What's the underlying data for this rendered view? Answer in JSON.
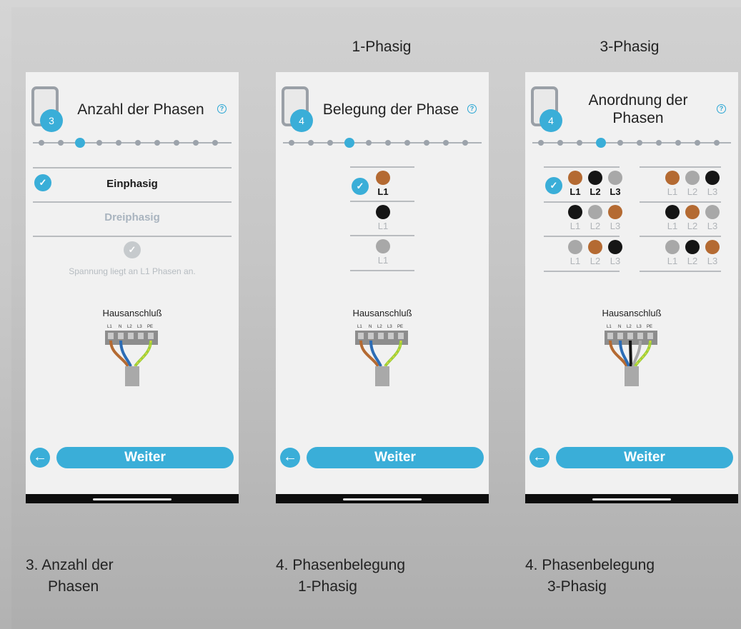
{
  "headers": {
    "one_phase": "1-Phasig",
    "three_phase": "3-Phasig"
  },
  "screens": [
    {
      "title": "Anzahl der Phasen",
      "step": "3",
      "options": [
        "Einphasig",
        "Dreiphasig"
      ],
      "hint": "Spannung liegt an L1 Phasen an.",
      "wiring_title": "Hausanschluß",
      "next_label": "Weiter",
      "back_icon": "←"
    },
    {
      "title": "Belegung der Phase",
      "step": "4",
      "phase_label": "L1",
      "wiring_title": "Hausanschluß",
      "next_label": "Weiter",
      "back_icon": "←"
    },
    {
      "title": "Anordnung der Phasen",
      "step": "4",
      "phase_labels": [
        "L1",
        "L2",
        "L3"
      ],
      "wiring_title": "Hausanschluß",
      "next_label": "Weiter",
      "back_icon": "←"
    }
  ],
  "terminal_labels": [
    "L1",
    "N",
    "L2",
    "L3",
    "PE"
  ],
  "help_glyph": "?",
  "check_glyph": "✓",
  "colors": {
    "accent": "#3aaed8",
    "brown": "#b46a32",
    "black": "#151515",
    "grey": "#a8a8a8",
    "blue": "#2c6cb5",
    "green_yellow": "#9bd13a"
  },
  "captions": [
    {
      "line1": "3. Anzahl der",
      "line2": "Phasen"
    },
    {
      "line1": "4. Phasenbelegung",
      "line2": "1-Phasig"
    },
    {
      "line1": "4. Phasenbelegung",
      "line2": "3-Phasig"
    }
  ]
}
